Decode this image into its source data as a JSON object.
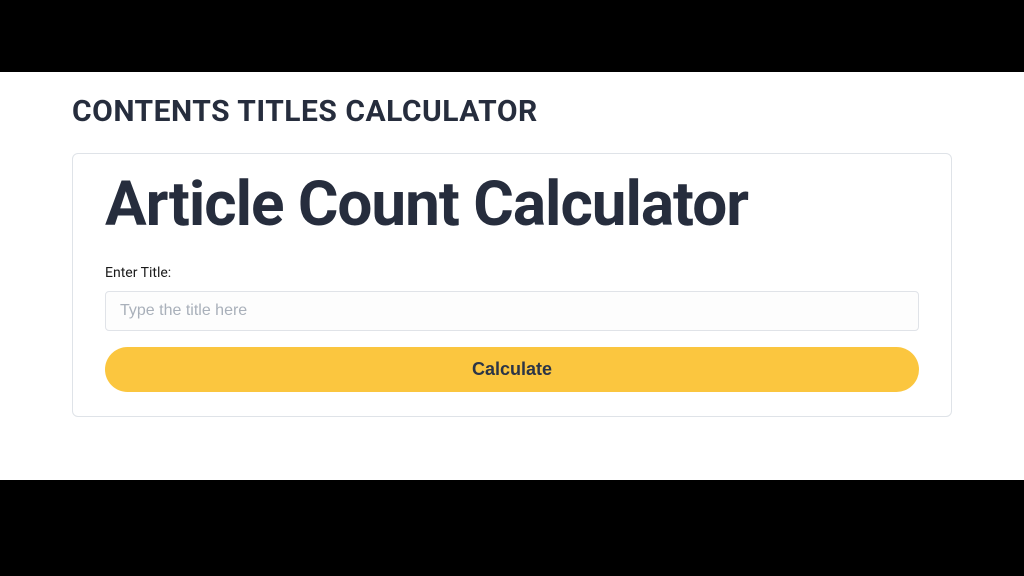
{
  "page": {
    "title": "CONTENTS TITLES CALCULATOR"
  },
  "card": {
    "title": "Article Count Calculator",
    "field_label": "Enter Title:",
    "input_placeholder": "Type the title here",
    "button_label": "Calculate"
  }
}
